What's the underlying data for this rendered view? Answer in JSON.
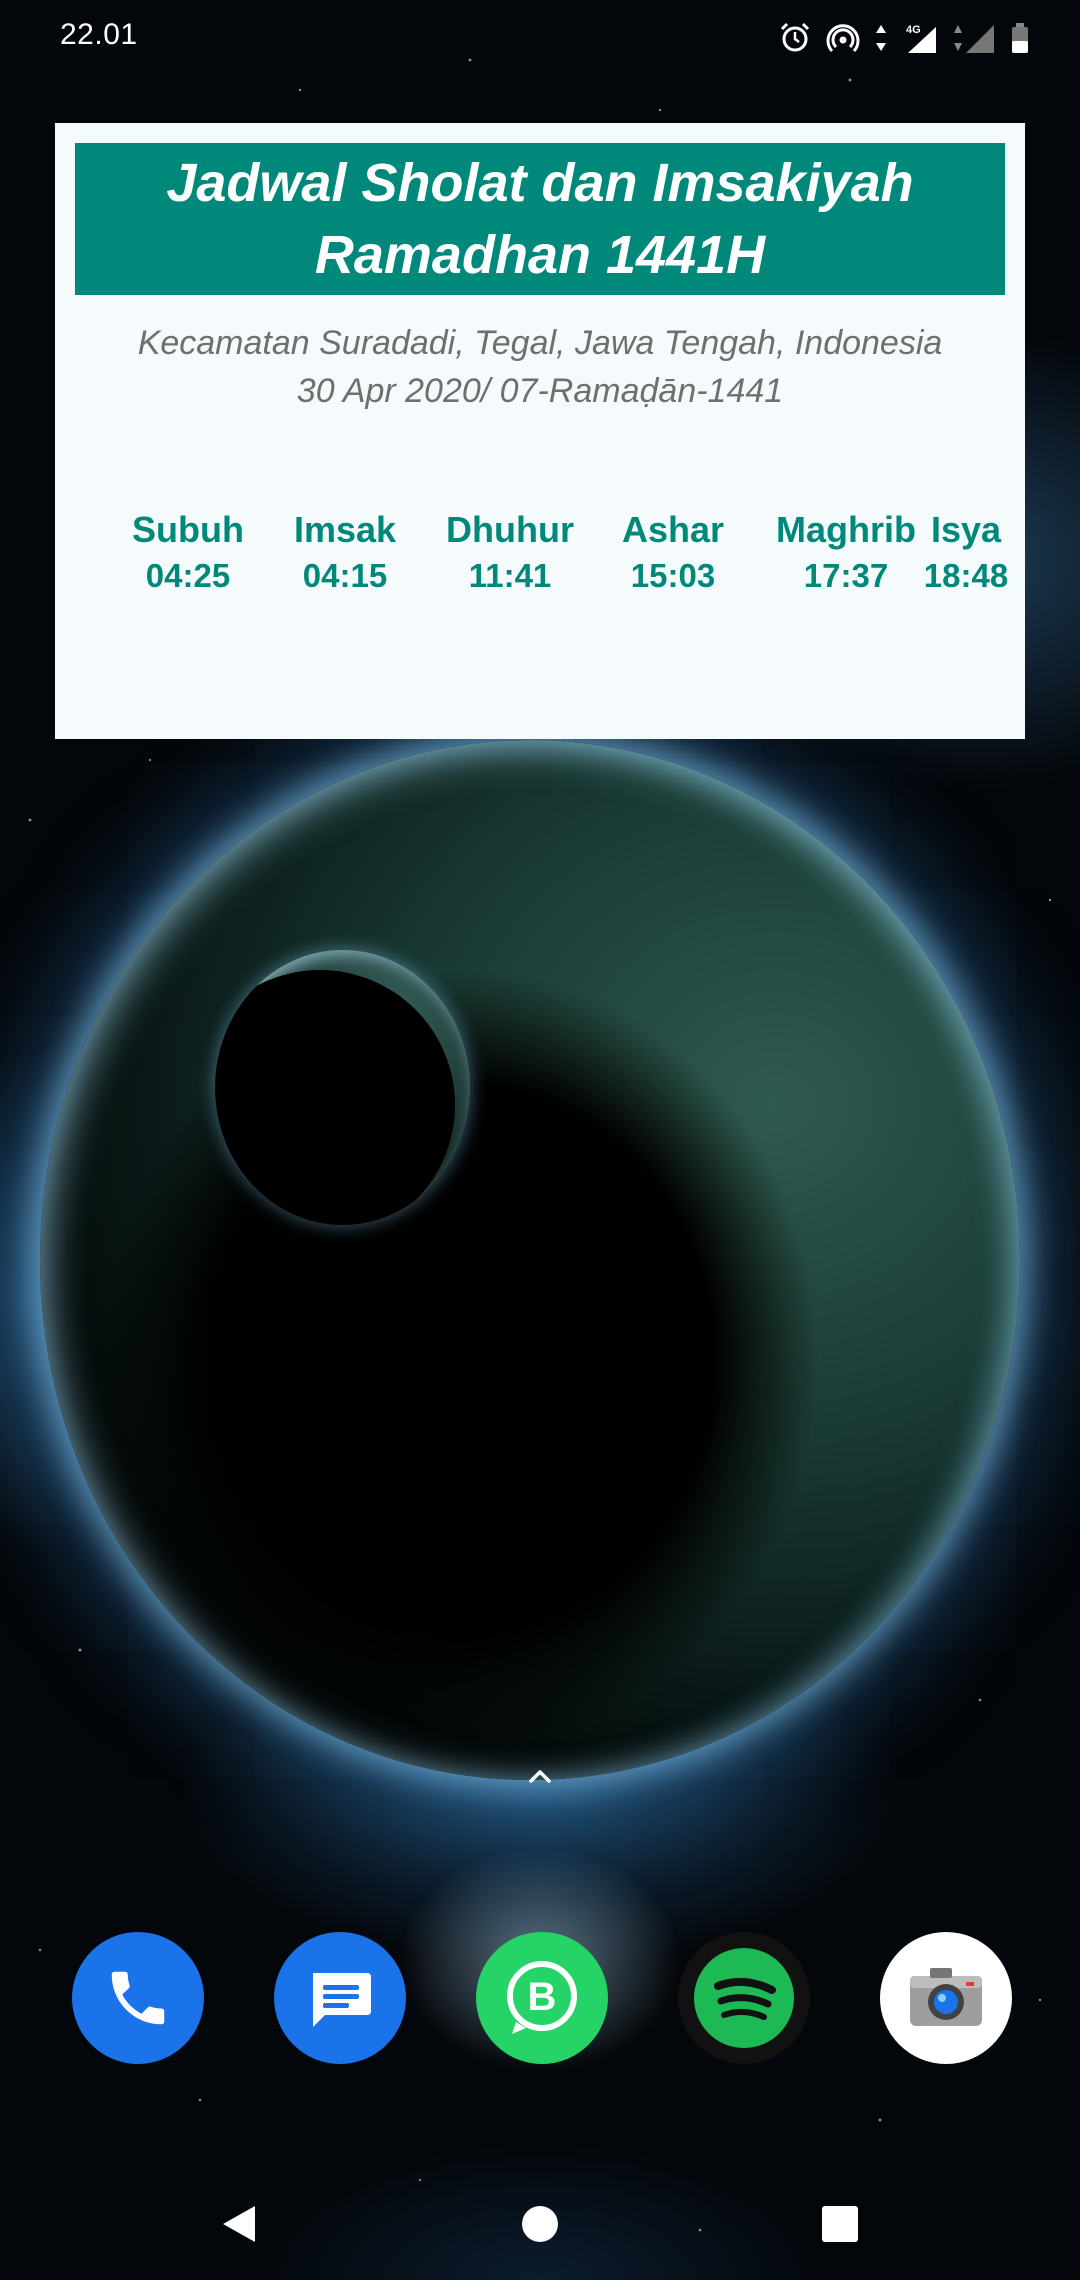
{
  "status_bar": {
    "time": "22.01",
    "icons": [
      "alarm-icon",
      "hotspot-icon",
      "data-arrows-icon",
      "signal-4g-icon",
      "signal-icon",
      "battery-icon"
    ],
    "network_label": "4G"
  },
  "widget": {
    "title_line1": "Jadwal Sholat dan Imsakiyah",
    "title_line2": "Ramadhan 1441H",
    "location": "Kecamatan Suradadi, Tegal, Jawa Tengah, Indonesia",
    "date": "30 Apr 2020/ 07-Ramaḍān-1441",
    "prayers": [
      {
        "name": "Subuh",
        "time": "04:25"
      },
      {
        "name": "Imsak",
        "time": "04:15"
      },
      {
        "name": "Dhuhur",
        "time": "11:41"
      },
      {
        "name": "Ashar",
        "time": "15:03"
      },
      {
        "name": "Maghrib",
        "time": "17:37"
      },
      {
        "name": "Isya",
        "time": "18:48"
      }
    ],
    "colors": {
      "header_bg": "#00897b",
      "background": "#f5fbfc",
      "prayer_text": "#00897b",
      "location_text": "#6f6f6f"
    }
  },
  "dock": {
    "apps": [
      {
        "name": "phone-icon",
        "color": "#1a73e8"
      },
      {
        "name": "messages-icon",
        "color": "#1a73e8"
      },
      {
        "name": "whatsapp-business-icon",
        "color": "#25d366"
      },
      {
        "name": "spotify-icon",
        "color": "#1db954"
      },
      {
        "name": "camera-icon",
        "color": "#ffffff"
      }
    ]
  },
  "nav_bar": {
    "buttons": [
      "back-icon",
      "home-icon",
      "recents-icon"
    ]
  }
}
